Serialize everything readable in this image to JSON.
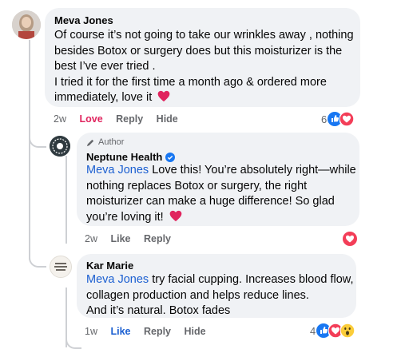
{
  "comments": [
    {
      "author": "Meva Jones",
      "lines": [
        "Of course it’s not going to take our wrinkles away , nothing",
        "besides Botox or surgery does but this moisturizer is the",
        "best I’ve ever tried .",
        "I tried it for the first time a month ago & ordered more",
        "immediately, love it"
      ],
      "emoji": "heart",
      "time": "2w",
      "reaction_label": "Love",
      "reply_label": "Reply",
      "hide_label": "Hide",
      "reaction_count": "6"
    },
    {
      "badge": "Author",
      "author": "Neptune Health",
      "verified": true,
      "mention": "Meva Jones",
      "first_line_rest": " Love this! You’re absolutely right—while",
      "lines": [
        "nothing replaces Botox or surgery, the right",
        "moisturizer can make a huge difference! So glad",
        "you’re loving it!"
      ],
      "emoji": "heart",
      "time": "2w",
      "like_label": "Like",
      "reply_label": "Reply"
    },
    {
      "author": "Kar Marie",
      "mention": "Meva Jones",
      "first_line_rest": " try facial cupping. Increases blood flow,",
      "lines": [
        "collagen production and helps reduce lines.",
        "And it’s natural. Botox fades"
      ],
      "time": "1w",
      "like_label": "Like",
      "reply_label": "Reply",
      "hide_label": "Hide",
      "reaction_count": "4"
    }
  ],
  "colors": {
    "bubble": "#f0f2f5",
    "mention": "#1b5fd1",
    "love": "#e0245e",
    "like": "#1b5fd1",
    "muted": "#65676b"
  }
}
